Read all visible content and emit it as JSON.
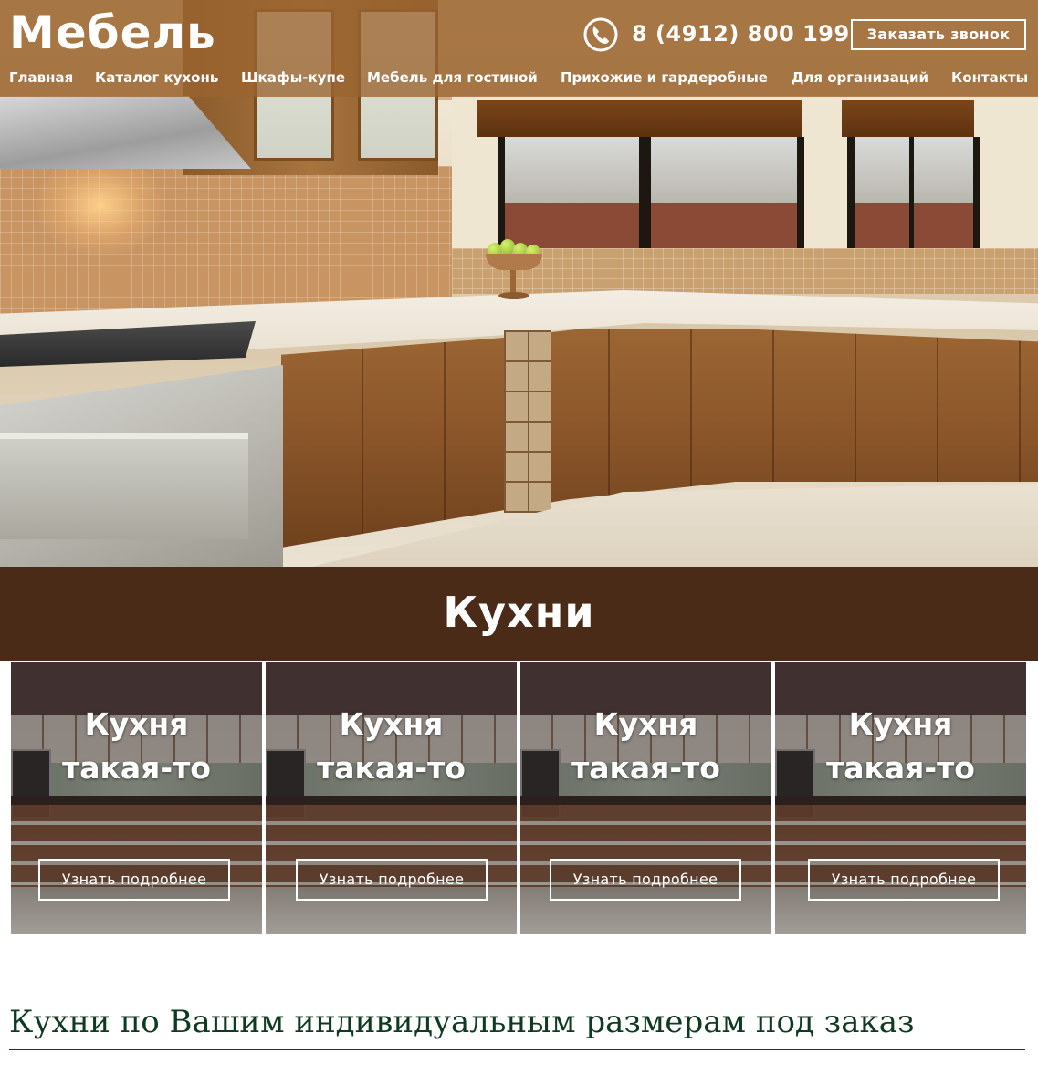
{
  "header": {
    "logo": "Мебель",
    "phone_icon": "phone-icon",
    "phone": "8 (4912) 800 199",
    "callback_button": "Заказать звонок"
  },
  "nav": {
    "items": [
      {
        "label": "Главная"
      },
      {
        "label": "Каталог кухонь"
      },
      {
        "label": "Шкафы-купе"
      },
      {
        "label": "Мебель для гостиной"
      },
      {
        "label": "Прихожие и гардеробные"
      },
      {
        "label": "Для организаций"
      },
      {
        "label": "Контакты"
      }
    ]
  },
  "section": {
    "title": "Кухни"
  },
  "cards": [
    {
      "title_line1": "Кухня",
      "title_line2": "такая-то",
      "button": "Узнать подробнее"
    },
    {
      "title_line1": "Кухня",
      "title_line2": "такая-то",
      "button": "Узнать подробнее"
    },
    {
      "title_line1": "Кухня",
      "title_line2": "такая-то",
      "button": "Узнать подробнее"
    },
    {
      "title_line1": "Кухня",
      "title_line2": "такая-то",
      "button": "Узнать подробнее"
    }
  ],
  "content": {
    "heading": "Кухни по Вашим индивидуальным размерам под заказ"
  },
  "colors": {
    "header_overlay": "#9a6430",
    "section_banner": "#4a2b17",
    "heading_text": "#0f3a22",
    "text_on_dark": "#ffffff"
  }
}
